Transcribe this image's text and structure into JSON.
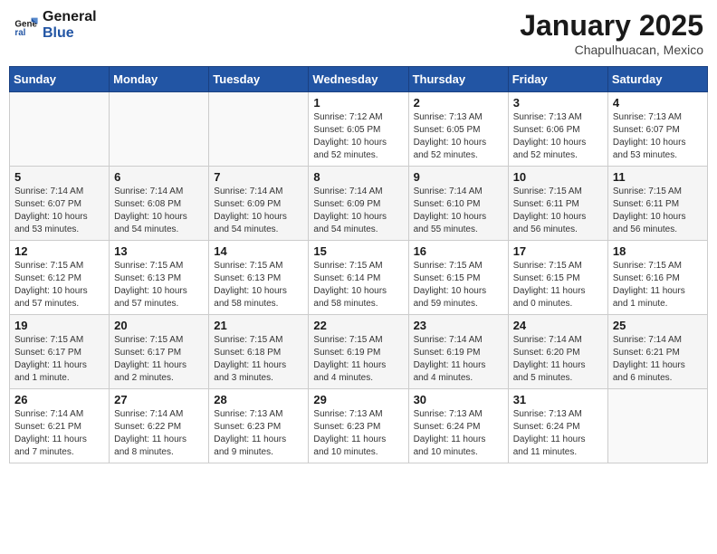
{
  "header": {
    "logo_line1": "General",
    "logo_line2": "Blue",
    "title": "January 2025",
    "subtitle": "Chapulhuacan, Mexico"
  },
  "weekdays": [
    "Sunday",
    "Monday",
    "Tuesday",
    "Wednesday",
    "Thursday",
    "Friday",
    "Saturday"
  ],
  "weeks": [
    [
      {
        "day": "",
        "info": ""
      },
      {
        "day": "",
        "info": ""
      },
      {
        "day": "",
        "info": ""
      },
      {
        "day": "1",
        "info": "Sunrise: 7:12 AM\nSunset: 6:05 PM\nDaylight: 10 hours\nand 52 minutes."
      },
      {
        "day": "2",
        "info": "Sunrise: 7:13 AM\nSunset: 6:05 PM\nDaylight: 10 hours\nand 52 minutes."
      },
      {
        "day": "3",
        "info": "Sunrise: 7:13 AM\nSunset: 6:06 PM\nDaylight: 10 hours\nand 52 minutes."
      },
      {
        "day": "4",
        "info": "Sunrise: 7:13 AM\nSunset: 6:07 PM\nDaylight: 10 hours\nand 53 minutes."
      }
    ],
    [
      {
        "day": "5",
        "info": "Sunrise: 7:14 AM\nSunset: 6:07 PM\nDaylight: 10 hours\nand 53 minutes."
      },
      {
        "day": "6",
        "info": "Sunrise: 7:14 AM\nSunset: 6:08 PM\nDaylight: 10 hours\nand 54 minutes."
      },
      {
        "day": "7",
        "info": "Sunrise: 7:14 AM\nSunset: 6:09 PM\nDaylight: 10 hours\nand 54 minutes."
      },
      {
        "day": "8",
        "info": "Sunrise: 7:14 AM\nSunset: 6:09 PM\nDaylight: 10 hours\nand 54 minutes."
      },
      {
        "day": "9",
        "info": "Sunrise: 7:14 AM\nSunset: 6:10 PM\nDaylight: 10 hours\nand 55 minutes."
      },
      {
        "day": "10",
        "info": "Sunrise: 7:15 AM\nSunset: 6:11 PM\nDaylight: 10 hours\nand 56 minutes."
      },
      {
        "day": "11",
        "info": "Sunrise: 7:15 AM\nSunset: 6:11 PM\nDaylight: 10 hours\nand 56 minutes."
      }
    ],
    [
      {
        "day": "12",
        "info": "Sunrise: 7:15 AM\nSunset: 6:12 PM\nDaylight: 10 hours\nand 57 minutes."
      },
      {
        "day": "13",
        "info": "Sunrise: 7:15 AM\nSunset: 6:13 PM\nDaylight: 10 hours\nand 57 minutes."
      },
      {
        "day": "14",
        "info": "Sunrise: 7:15 AM\nSunset: 6:13 PM\nDaylight: 10 hours\nand 58 minutes."
      },
      {
        "day": "15",
        "info": "Sunrise: 7:15 AM\nSunset: 6:14 PM\nDaylight: 10 hours\nand 58 minutes."
      },
      {
        "day": "16",
        "info": "Sunrise: 7:15 AM\nSunset: 6:15 PM\nDaylight: 10 hours\nand 59 minutes."
      },
      {
        "day": "17",
        "info": "Sunrise: 7:15 AM\nSunset: 6:15 PM\nDaylight: 11 hours\nand 0 minutes."
      },
      {
        "day": "18",
        "info": "Sunrise: 7:15 AM\nSunset: 6:16 PM\nDaylight: 11 hours\nand 1 minute."
      }
    ],
    [
      {
        "day": "19",
        "info": "Sunrise: 7:15 AM\nSunset: 6:17 PM\nDaylight: 11 hours\nand 1 minute."
      },
      {
        "day": "20",
        "info": "Sunrise: 7:15 AM\nSunset: 6:17 PM\nDaylight: 11 hours\nand 2 minutes."
      },
      {
        "day": "21",
        "info": "Sunrise: 7:15 AM\nSunset: 6:18 PM\nDaylight: 11 hours\nand 3 minutes."
      },
      {
        "day": "22",
        "info": "Sunrise: 7:15 AM\nSunset: 6:19 PM\nDaylight: 11 hours\nand 4 minutes."
      },
      {
        "day": "23",
        "info": "Sunrise: 7:14 AM\nSunset: 6:19 PM\nDaylight: 11 hours\nand 4 minutes."
      },
      {
        "day": "24",
        "info": "Sunrise: 7:14 AM\nSunset: 6:20 PM\nDaylight: 11 hours\nand 5 minutes."
      },
      {
        "day": "25",
        "info": "Sunrise: 7:14 AM\nSunset: 6:21 PM\nDaylight: 11 hours\nand 6 minutes."
      }
    ],
    [
      {
        "day": "26",
        "info": "Sunrise: 7:14 AM\nSunset: 6:21 PM\nDaylight: 11 hours\nand 7 minutes."
      },
      {
        "day": "27",
        "info": "Sunrise: 7:14 AM\nSunset: 6:22 PM\nDaylight: 11 hours\nand 8 minutes."
      },
      {
        "day": "28",
        "info": "Sunrise: 7:13 AM\nSunset: 6:23 PM\nDaylight: 11 hours\nand 9 minutes."
      },
      {
        "day": "29",
        "info": "Sunrise: 7:13 AM\nSunset: 6:23 PM\nDaylight: 11 hours\nand 10 minutes."
      },
      {
        "day": "30",
        "info": "Sunrise: 7:13 AM\nSunset: 6:24 PM\nDaylight: 11 hours\nand 10 minutes."
      },
      {
        "day": "31",
        "info": "Sunrise: 7:13 AM\nSunset: 6:24 PM\nDaylight: 11 hours\nand 11 minutes."
      },
      {
        "day": "",
        "info": ""
      }
    ]
  ]
}
